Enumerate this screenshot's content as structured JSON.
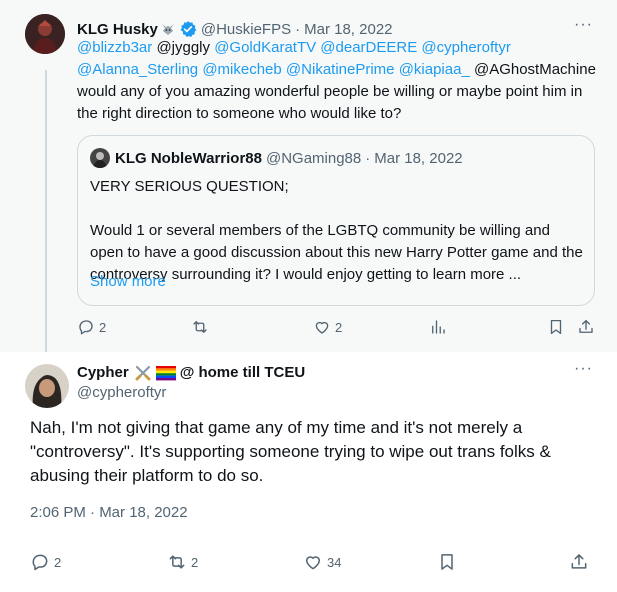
{
  "tweet1": {
    "display_name": "KLG Husky",
    "name_emoji": "wolf-emoji",
    "verified_icon": "verified-badge-icon",
    "handle": "@HuskieFPS",
    "separator": "·",
    "date": "Mar 18, 2022",
    "more": "···",
    "body_mentions_line1": [
      "@blizzb3ar"
    ],
    "text_jyggly": "@jyggly",
    "mentions_a": [
      "@GoldKaratTV",
      "@dearDEERE",
      "@cypheroftyr"
    ],
    "mentions_b": [
      "@Alanna_Sterling",
      "@mikecheb",
      "@NikatinePrime",
      "@kiapiaa_"
    ],
    "text_aghost": "@AGhostMachine",
    "body_text": "would any of you amazing wonderful people be willing or maybe point him in the right direction to someone who would like to?",
    "quote": {
      "display_name": "KLG NobleWarrior88",
      "handle": "@NGaming88",
      "separator": "·",
      "date": "Mar 18, 2022",
      "line1": "VERY SERIOUS QUESTION;",
      "line2": "Would 1 or several members of the LGBTQ community be willing and open to have a good discussion about this new Harry Potter game and the controversy surrounding it? I would enjoy getting to learn more ...",
      "show_more": "Show more"
    },
    "actions": {
      "reply_count": "2",
      "retweet_count": "",
      "like_count": "2"
    }
  },
  "tweet2": {
    "display_name": "Cypher",
    "name_emojis": [
      "crossed-swords-emoji",
      "rainbow-flag-emoji"
    ],
    "name_suffix": "@ home till TCEU",
    "handle": "@cypheroftyr",
    "more": "···",
    "text": "Nah, I'm not giving that game any of my time and it's not merely a \"controversy\". It's supporting someone trying to wipe out trans folks & abusing their platform to do so.",
    "timestamp": "2:06 PM · Mar 18, 2022",
    "actions": {
      "reply_count": "2",
      "retweet_count": "2",
      "like_count": "34"
    }
  },
  "colors": {
    "link": "#1d9bf0",
    "muted": "#536471",
    "text": "#0f1419",
    "thread_bg": "#f7f9f9",
    "border": "#cfd9de",
    "verified": "#1d9bf0"
  }
}
